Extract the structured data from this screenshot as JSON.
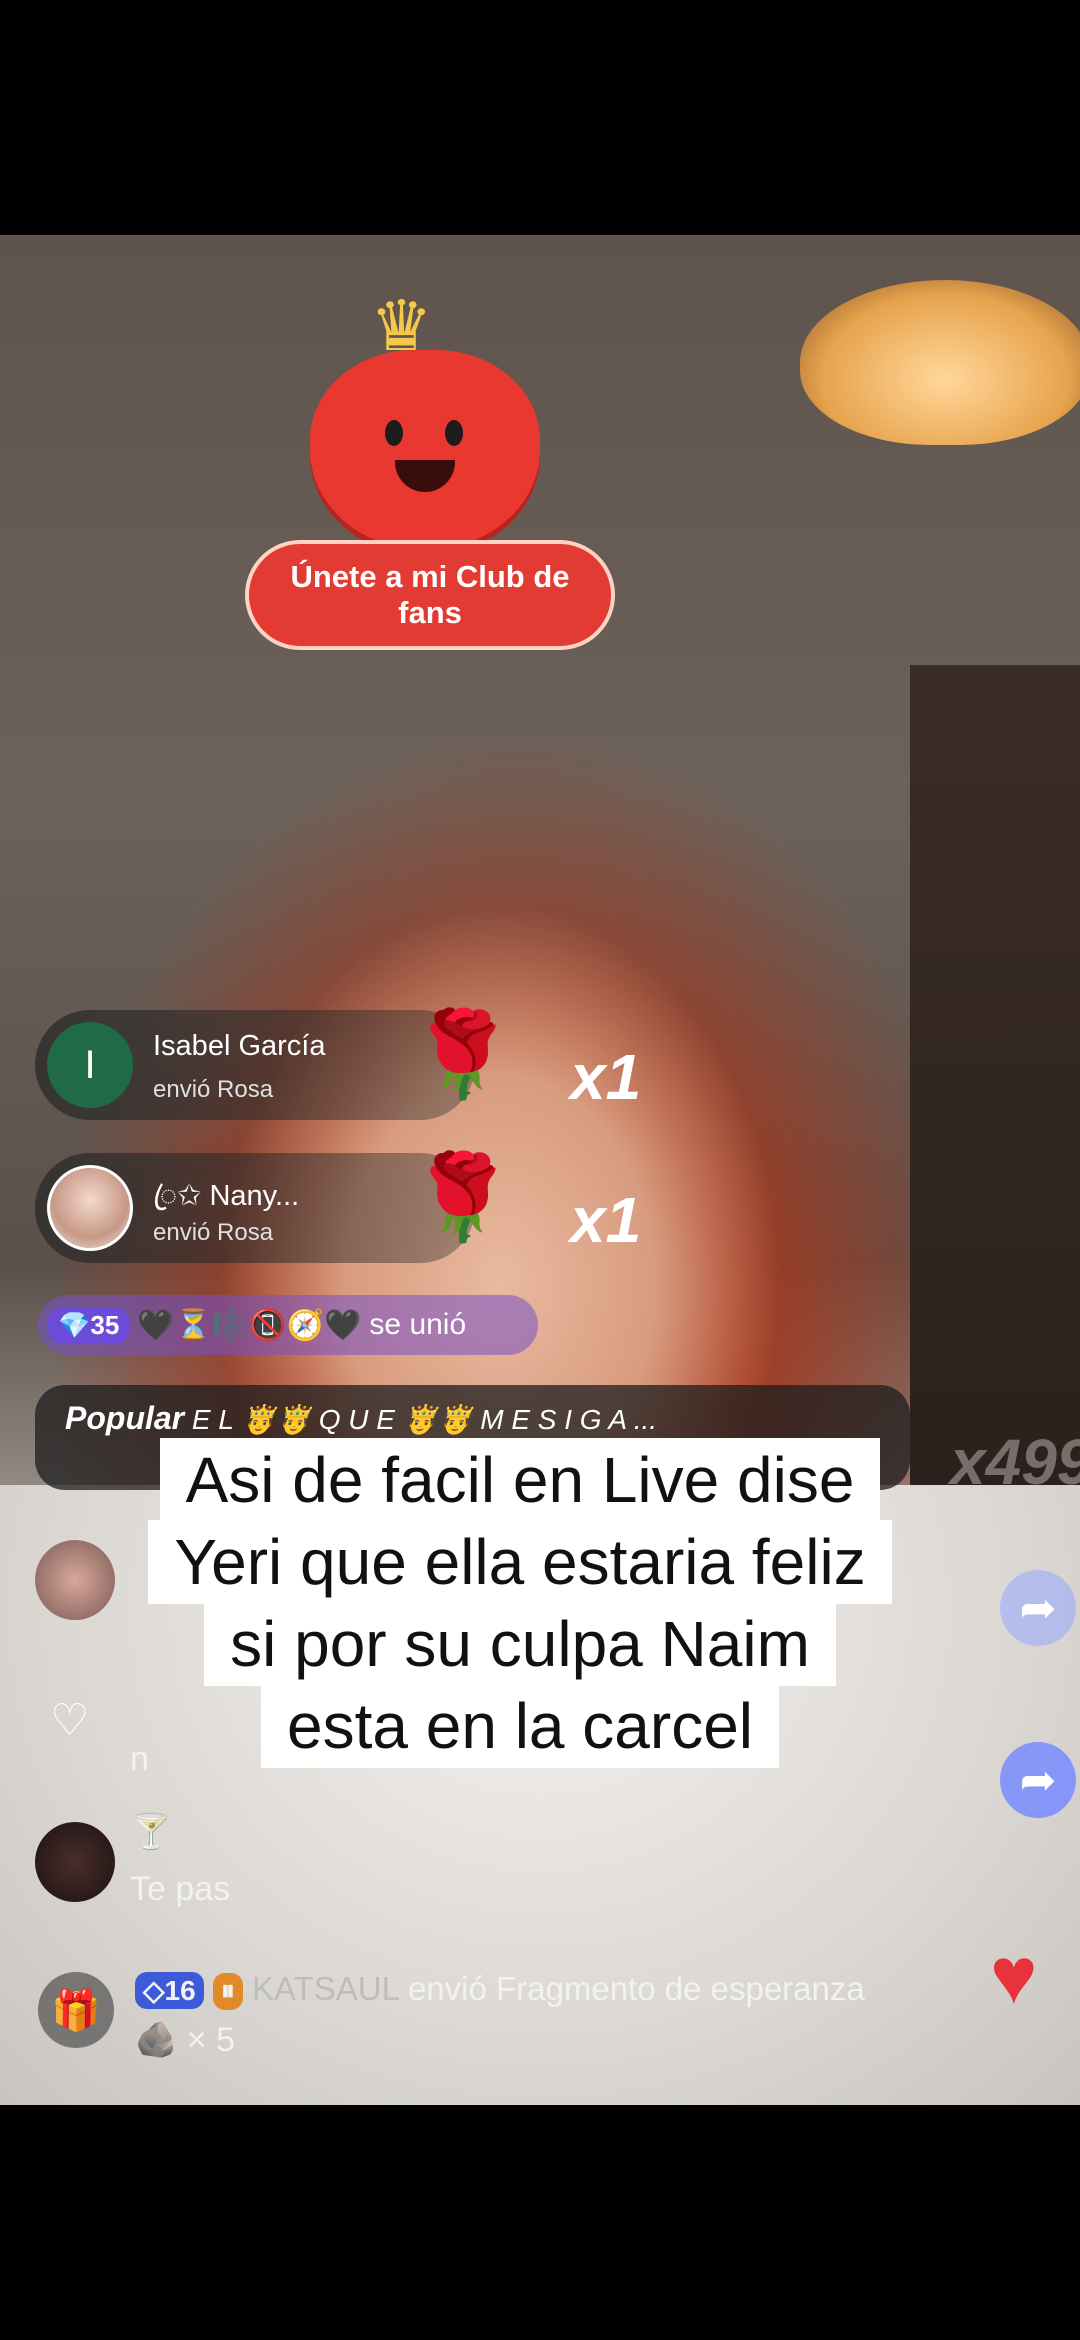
{
  "club": {
    "label": "Únete a mi Club de fans"
  },
  "gifts": [
    {
      "avatar_letter": "I",
      "name": "Isabel García",
      "sub": "envió Rosa",
      "item": "🌹",
      "count": "x1"
    },
    {
      "name": "ꦿ✩ Nany...",
      "sub": "envió Rosa",
      "item": "🌹",
      "count": "x1"
    }
  ],
  "joined": {
    "level": "💎35",
    "emojis": "🖤⏳🎼📵🧭🖤",
    "text": "se unió"
  },
  "popular": {
    "label": "Popular",
    "text": "E L 🤴🤴 Q U E 🤴🤴 M E S I G A ..."
  },
  "multiplier_ghost": "x499",
  "caption": {
    "lines": [
      "Asi de facil en Live dise",
      "Yeri que ella estaria feliz",
      "si por su culpa Naim",
      "esta en la carcel"
    ]
  },
  "comments": {
    "partial_1": "n",
    "drink_emoji": "🍸",
    "partial_2": "Te pas"
  },
  "bottom": {
    "badge1": "◇16",
    "badge2": "⏸",
    "user": "KATSAUL",
    "text": "envió Fragmento de esperanza",
    "item_icon": "🪨",
    "item_count": "× 5"
  },
  "colors": {
    "caption_bg": "#ffffff",
    "like": "#e8333b",
    "share": "#7b8cff"
  }
}
